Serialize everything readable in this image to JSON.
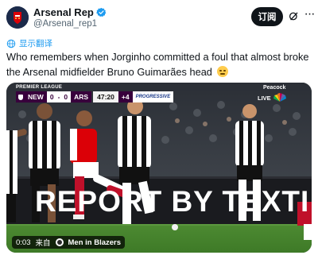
{
  "header": {
    "display_name": "Arsenal Rep",
    "handle": "@Arsenal_rep1",
    "follow_label": "订阅",
    "icons": {
      "avatar": "arsenal-crest-avatar",
      "verified": "verified-badge-icon",
      "grok": "grok-icon",
      "more": "more-icon"
    }
  },
  "translate": {
    "label": "显示翻译",
    "icon": "translate-icon"
  },
  "tweet": {
    "text": "Who remembers when Jorginho committed a foul that almost broke the Arsenal midfielder Bruno Guimarães head",
    "emoji": "worried-face"
  },
  "video": {
    "league": "PREMIER LEAGUE",
    "scorebug": {
      "home_team": "NEW",
      "home_score": "0",
      "separator": "-",
      "away_score": "0",
      "away_team": "ARS",
      "clock": "47:20",
      "added_time": "+4",
      "sponsor": "PROGRESSIVE"
    },
    "broadcaster": "Peacock",
    "live_label": "LIVE",
    "board_text": "REPORT BY TEXTI",
    "timestamp": "0:03",
    "source_prefix": "来自",
    "source_name": "Men in Blazers"
  },
  "colors": {
    "link": "#1d9bf0",
    "follow_bg": "#0f1419",
    "verified": "#1d9bf0",
    "premier_league_purple": "#38003c"
  }
}
